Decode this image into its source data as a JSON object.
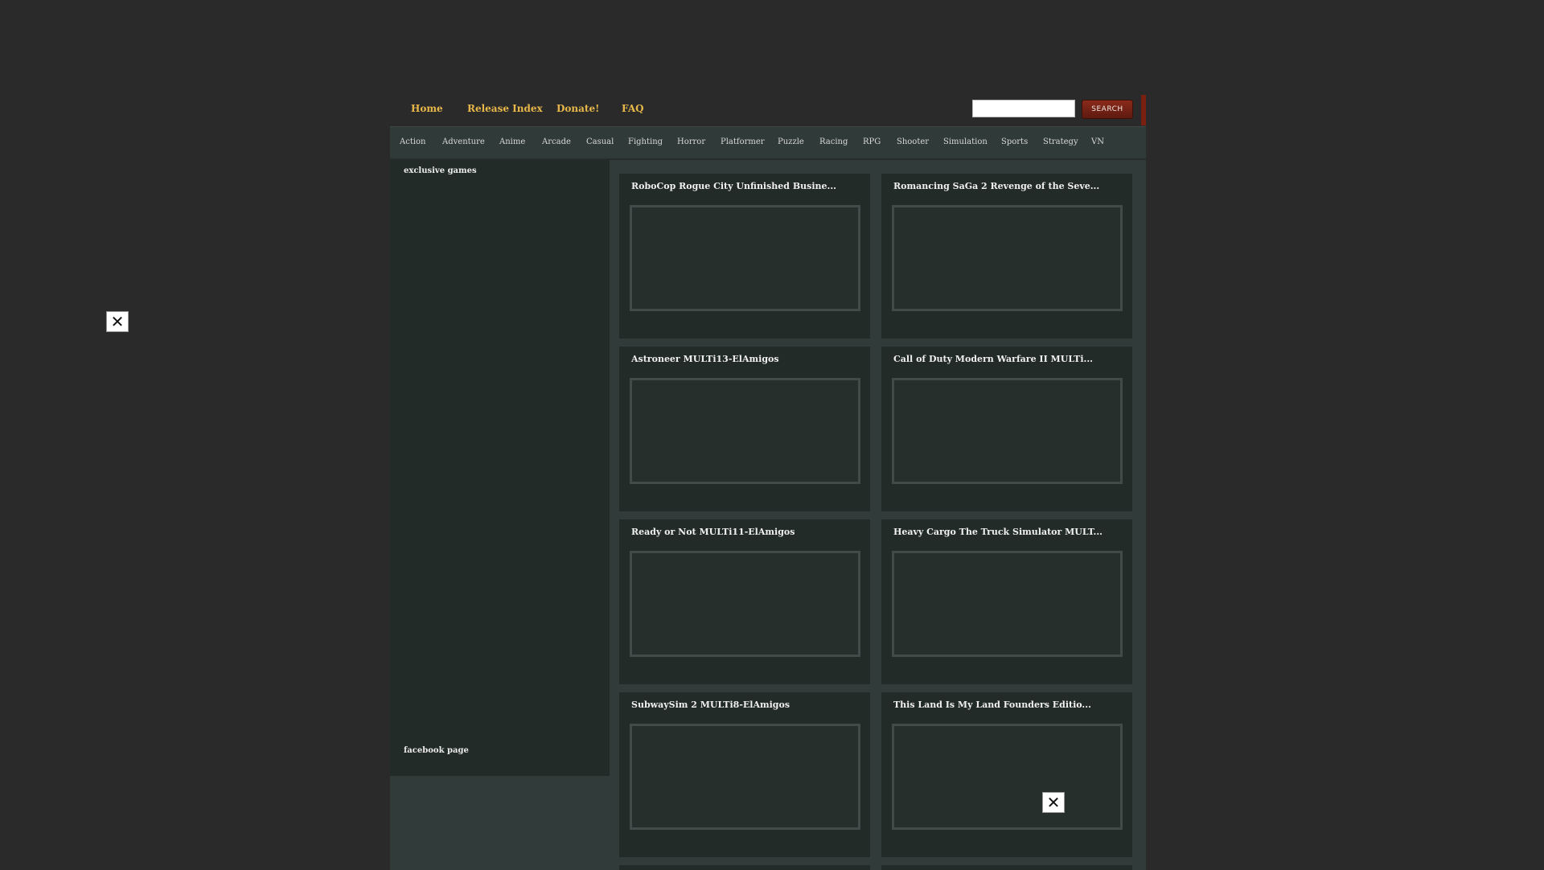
{
  "topnav": {
    "items": [
      {
        "label": "Home"
      },
      {
        "label": "Release Index"
      },
      {
        "label": "Donate!"
      },
      {
        "label": "FAQ"
      }
    ],
    "search_value": "",
    "search_button": "SEARCH"
  },
  "categories": [
    "Action",
    "Adventure",
    "Anime",
    "Arcade",
    "Casual",
    "Fighting",
    "Horror",
    "Platformer",
    "Puzzle",
    "Racing",
    "RPG",
    "Shooter",
    "Simulation",
    "Sports",
    "Strategy",
    "VN"
  ],
  "sidebar": {
    "exclusive_title": "exclusive games",
    "facebook_title": "facebook page"
  },
  "cards": [
    {
      "title": "RoboCop Rogue City Unfinished Busine..."
    },
    {
      "title": "Romancing SaGa 2 Revenge of the Seve..."
    },
    {
      "title": "Astroneer MULTi13-ElAmigos"
    },
    {
      "title": "Call of Duty Modern Warfare II MULTi..."
    },
    {
      "title": "Ready or Not MULTi11-ElAmigos"
    },
    {
      "title": "Heavy Cargo The Truck Simulator MULT..."
    },
    {
      "title": "SubwaySim 2 MULTi8-ElAmigos"
    },
    {
      "title": "This Land Is My Land Founders Editio..."
    }
  ],
  "overlays": {
    "close_glyph": "✕"
  }
}
